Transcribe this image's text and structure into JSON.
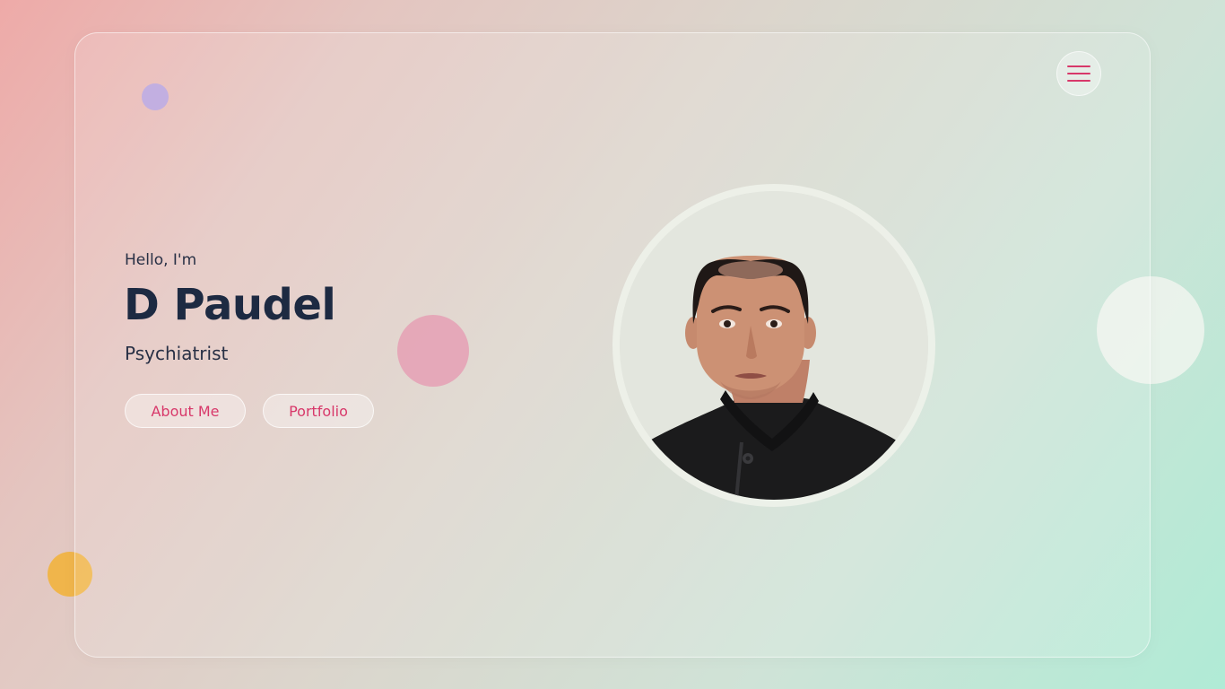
{
  "hero": {
    "greeting": "Hello, I'm",
    "name": "D Paudel",
    "profession": "Psychiatrist"
  },
  "buttons": {
    "about_label": "About Me",
    "portfolio_label": "Portfolio"
  },
  "icons": {
    "menu": "hamburger-menu-icon",
    "profile": "profile-photo"
  },
  "colors": {
    "accent": "#d8386a",
    "heading": "#1d2a42",
    "blob_purple": "#b3a0e0",
    "blob_pink": "#e5a4b6",
    "blob_yellow": "#f0b445"
  }
}
